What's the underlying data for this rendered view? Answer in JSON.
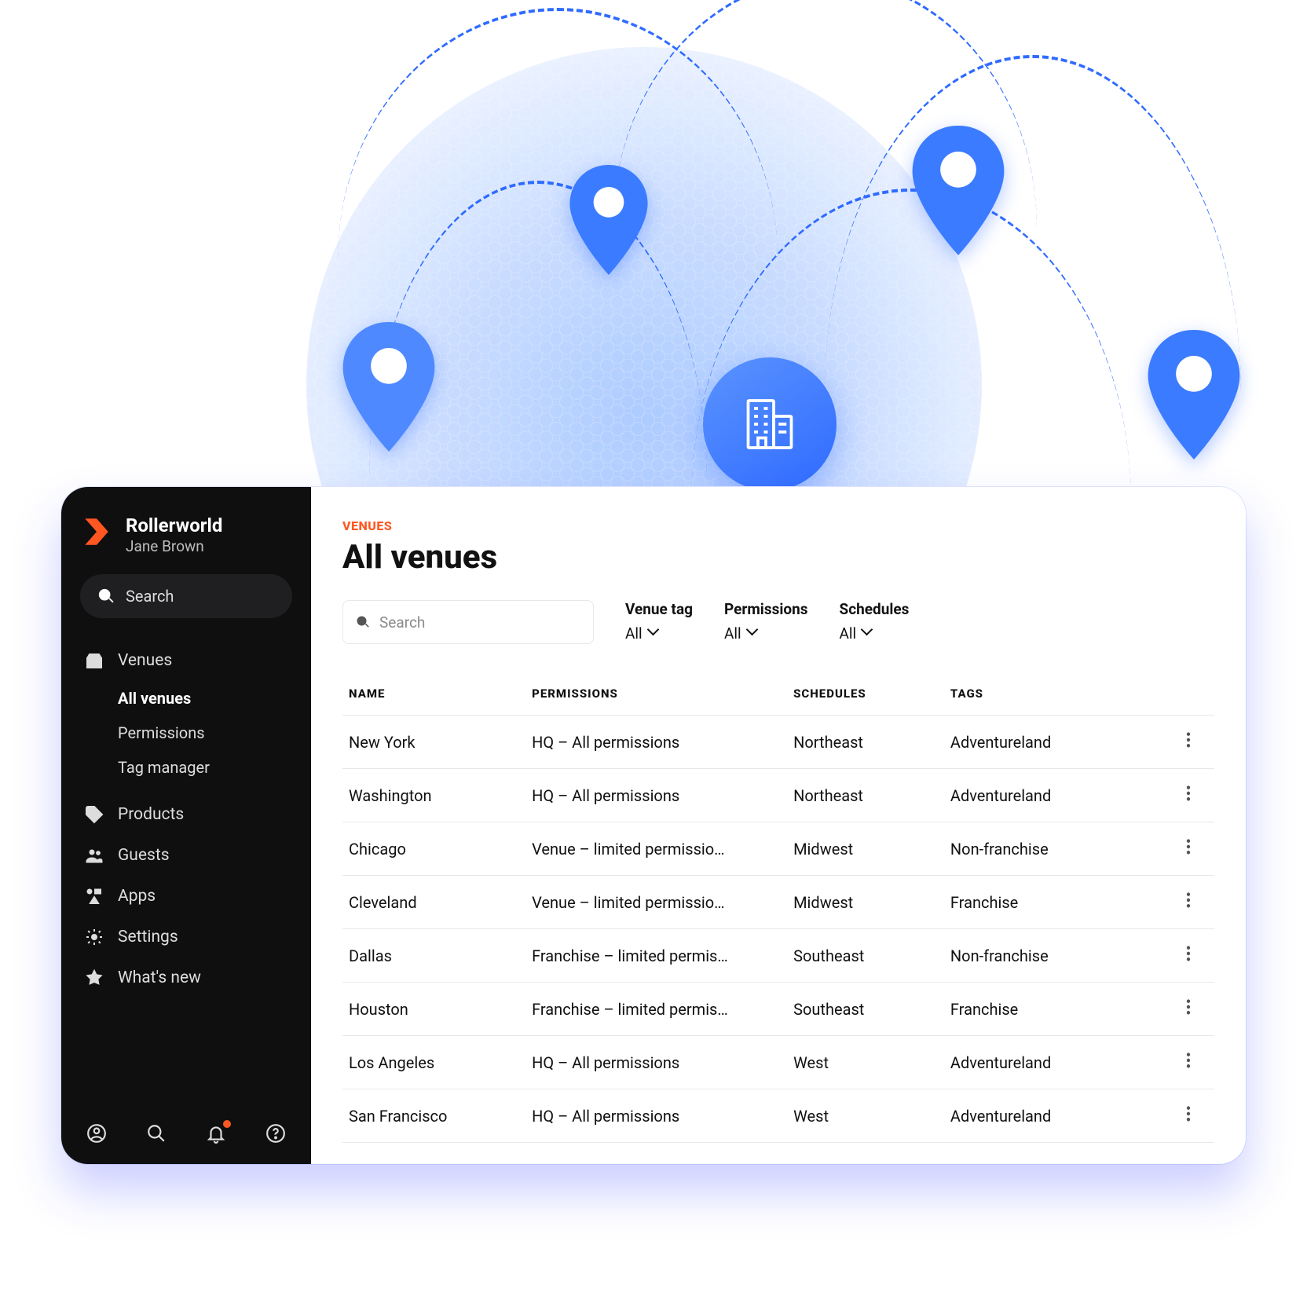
{
  "brand": {
    "name": "Rollerworld",
    "user": "Jane Brown"
  },
  "sidebar": {
    "search_placeholder": "Search",
    "items": [
      {
        "label": "Venues",
        "children": [
          {
            "label": "All venues",
            "active": true
          },
          {
            "label": "Permissions"
          },
          {
            "label": "Tag manager"
          }
        ]
      },
      {
        "label": "Products"
      },
      {
        "label": "Guests"
      },
      {
        "label": "Apps"
      },
      {
        "label": "Settings"
      },
      {
        "label": "What's new"
      }
    ]
  },
  "page": {
    "breadcrumb": "VENUES",
    "title": "All venues",
    "search_placeholder": "Search",
    "filters": [
      {
        "label": "Venue tag",
        "value": "All"
      },
      {
        "label": "Permissions",
        "value": "All"
      },
      {
        "label": "Schedules",
        "value": "All"
      }
    ],
    "columns": {
      "name": "NAME",
      "permissions": "PERMISSIONS",
      "schedules": "SCHEDULES",
      "tags": "TAGS"
    },
    "rows": [
      {
        "name": "New York",
        "permissions": "HQ – All permissions",
        "schedules": "Northeast",
        "tags": "Adventureland"
      },
      {
        "name": "Washington",
        "permissions": "HQ – All permissions",
        "schedules": "Northeast",
        "tags": "Adventureland"
      },
      {
        "name": "Chicago",
        "permissions": "Venue – limited permissio…",
        "schedules": "Midwest",
        "tags": "Non-franchise"
      },
      {
        "name": "Cleveland",
        "permissions": "Venue – limited permissio…",
        "schedules": "Midwest",
        "tags": "Franchise"
      },
      {
        "name": "Dallas",
        "permissions": "Franchise – limited permis…",
        "schedules": "Southeast",
        "tags": "Non-franchise"
      },
      {
        "name": "Houston",
        "permissions": "Franchise – limited permis…",
        "schedules": "Southeast",
        "tags": "Franchise"
      },
      {
        "name": "Los Angeles",
        "permissions": "HQ – All permissions",
        "schedules": "West",
        "tags": "Adventureland"
      },
      {
        "name": "San Francisco",
        "permissions": "HQ – All permissions",
        "schedules": "West",
        "tags": "Adventureland"
      }
    ]
  }
}
